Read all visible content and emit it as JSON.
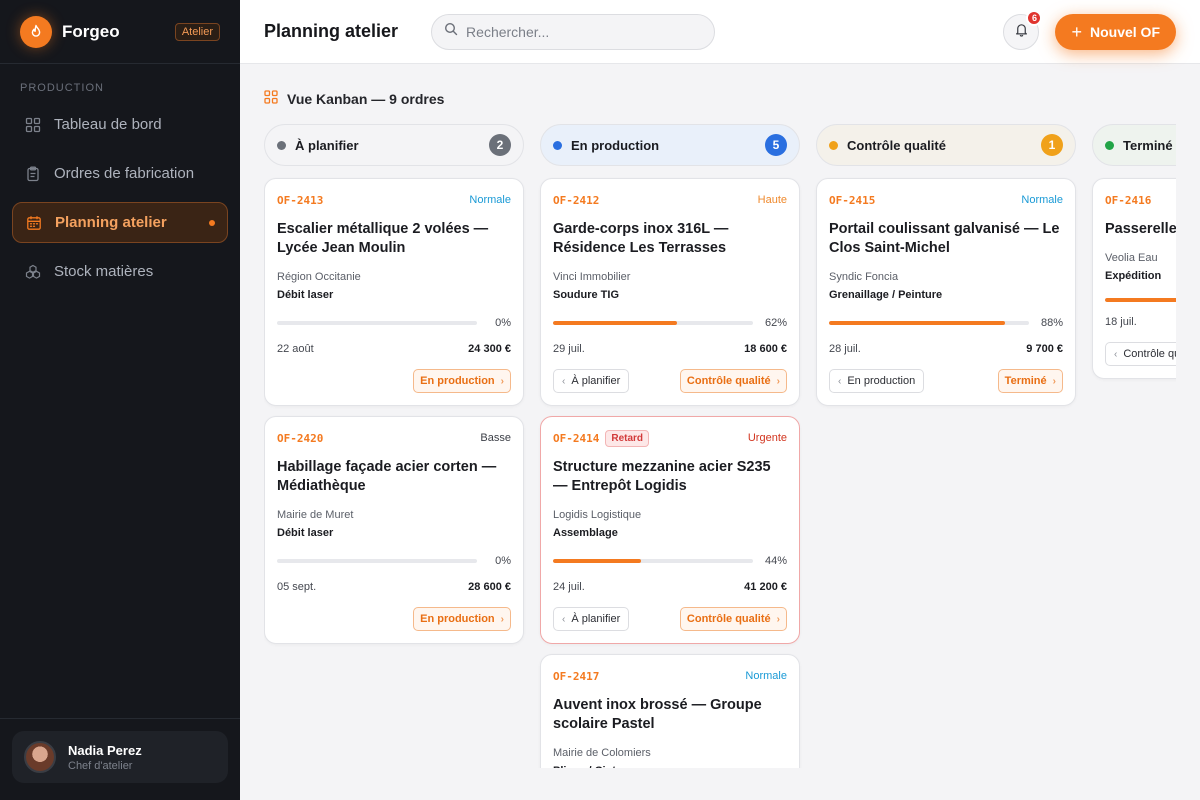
{
  "brand": {
    "name": "Forgeo",
    "badge": "Atelier"
  },
  "sidebar": {
    "section": "PRODUCTION",
    "items": [
      {
        "label": "Tableau de bord",
        "icon": "dashboard-icon"
      },
      {
        "label": "Ordres de fabrication",
        "icon": "clipboard-icon"
      },
      {
        "label": "Planning atelier",
        "icon": "calendar-icon",
        "active": true
      },
      {
        "label": "Stock matières",
        "icon": "stock-icon"
      }
    ],
    "user": {
      "name": "Nadia Perez",
      "role": "Chef d'atelier"
    }
  },
  "header": {
    "title": "Planning atelier",
    "search_placeholder": "Rechercher...",
    "notifications": "6",
    "new_button": "Nouvel OF"
  },
  "main": {
    "view_title": "Vue Kanban — 9 ordres",
    "columns": [
      {
        "title": "À planifier",
        "count": "2",
        "dot": "#6b7079",
        "count_bg": "#6b7079",
        "head_bg": "#f4f4f6",
        "cards": [
          {
            "ref": "OF-2413",
            "priority": "Normale",
            "prio_color": "#1a9ad6",
            "title": "Escalier métallique 2 volées — Lycée Jean Moulin",
            "client": "Région Occitanie",
            "step": "Débit laser",
            "progress": 0,
            "pct": "0%",
            "date": "22 août",
            "amount": "24 300 €",
            "back": "",
            "next": "En production",
            "late": ""
          },
          {
            "ref": "OF-2420",
            "priority": "Basse",
            "prio_color": "#3c3f47",
            "title": "Habillage façade acier corten — Médiathèque",
            "client": "Mairie de Muret",
            "step": "Débit laser",
            "progress": 0,
            "pct": "0%",
            "date": "05 sept.",
            "amount": "28 600 €",
            "back": "",
            "next": "En production",
            "late": ""
          }
        ]
      },
      {
        "title": "En production",
        "count": "5",
        "dot": "#2a6fe0",
        "count_bg": "#2a6fe0",
        "head_bg": "#e9f0fa",
        "cards": [
          {
            "ref": "OF-2412",
            "priority": "Haute",
            "prio_color": "#ef8a2e",
            "title": "Garde-corps inox 316L — Résidence Les Terrasses",
            "client": "Vinci Immobilier",
            "step": "Soudure TIG",
            "progress": 0.62,
            "pct": "62%",
            "date": "29 juil.",
            "amount": "18 600 €",
            "back": "À planifier",
            "next": "Contrôle qualité",
            "late": ""
          },
          {
            "ref": "OF-2414",
            "priority": "Urgente",
            "prio_color": "#d2351f",
            "title": "Structure mezzanine acier S235 — Entrepôt Logidis",
            "client": "Logidis Logistique",
            "step": "Assemblage",
            "progress": 0.44,
            "pct": "44%",
            "date": "24 juil.",
            "amount": "41 200 €",
            "back": "À planifier",
            "next": "Contrôle qualité",
            "late": "Retard"
          },
          {
            "ref": "OF-2417",
            "priority": "Normale",
            "prio_color": "#1a9ad6",
            "title": "Auvent inox brossé — Groupe scolaire Pastel",
            "client": "Mairie de Colomiers",
            "step": "Pliage / Cintrage",
            "progress": 0,
            "pct": "",
            "date": "",
            "amount": "",
            "back": "",
            "next": "",
            "late": ""
          }
        ]
      },
      {
        "title": "Contrôle qualité",
        "count": "1",
        "dot": "#f0a11a",
        "count_bg": "#f0a11a",
        "head_bg": "#f4f1ea",
        "cards": [
          {
            "ref": "OF-2415",
            "priority": "Normale",
            "prio_color": "#1a9ad6",
            "title": "Portail coulissant galvanisé — Le Clos Saint-Michel",
            "client": "Syndic Foncia",
            "step": "Grenaillage / Peinture",
            "progress": 0.88,
            "pct": "88%",
            "date": "28 juil.",
            "amount": "9 700 €",
            "back": "En production",
            "next": "Terminé",
            "late": ""
          }
        ]
      },
      {
        "title": "Terminé",
        "count": "",
        "dot": "#22a447",
        "count_bg": "#22a447",
        "head_bg": "#eef3ee",
        "cards": [
          {
            "ref": "OF-2416",
            "priority": "",
            "prio_color": "#1a9ad6",
            "title": "Passerelle — Station Veolia",
            "client": "Veolia Eau",
            "step": "Expédition",
            "progress": 1,
            "pct": "",
            "date": "18 juil.",
            "amount": "",
            "back": "Contrôle qualité",
            "next": "",
            "late": ""
          }
        ]
      }
    ]
  }
}
